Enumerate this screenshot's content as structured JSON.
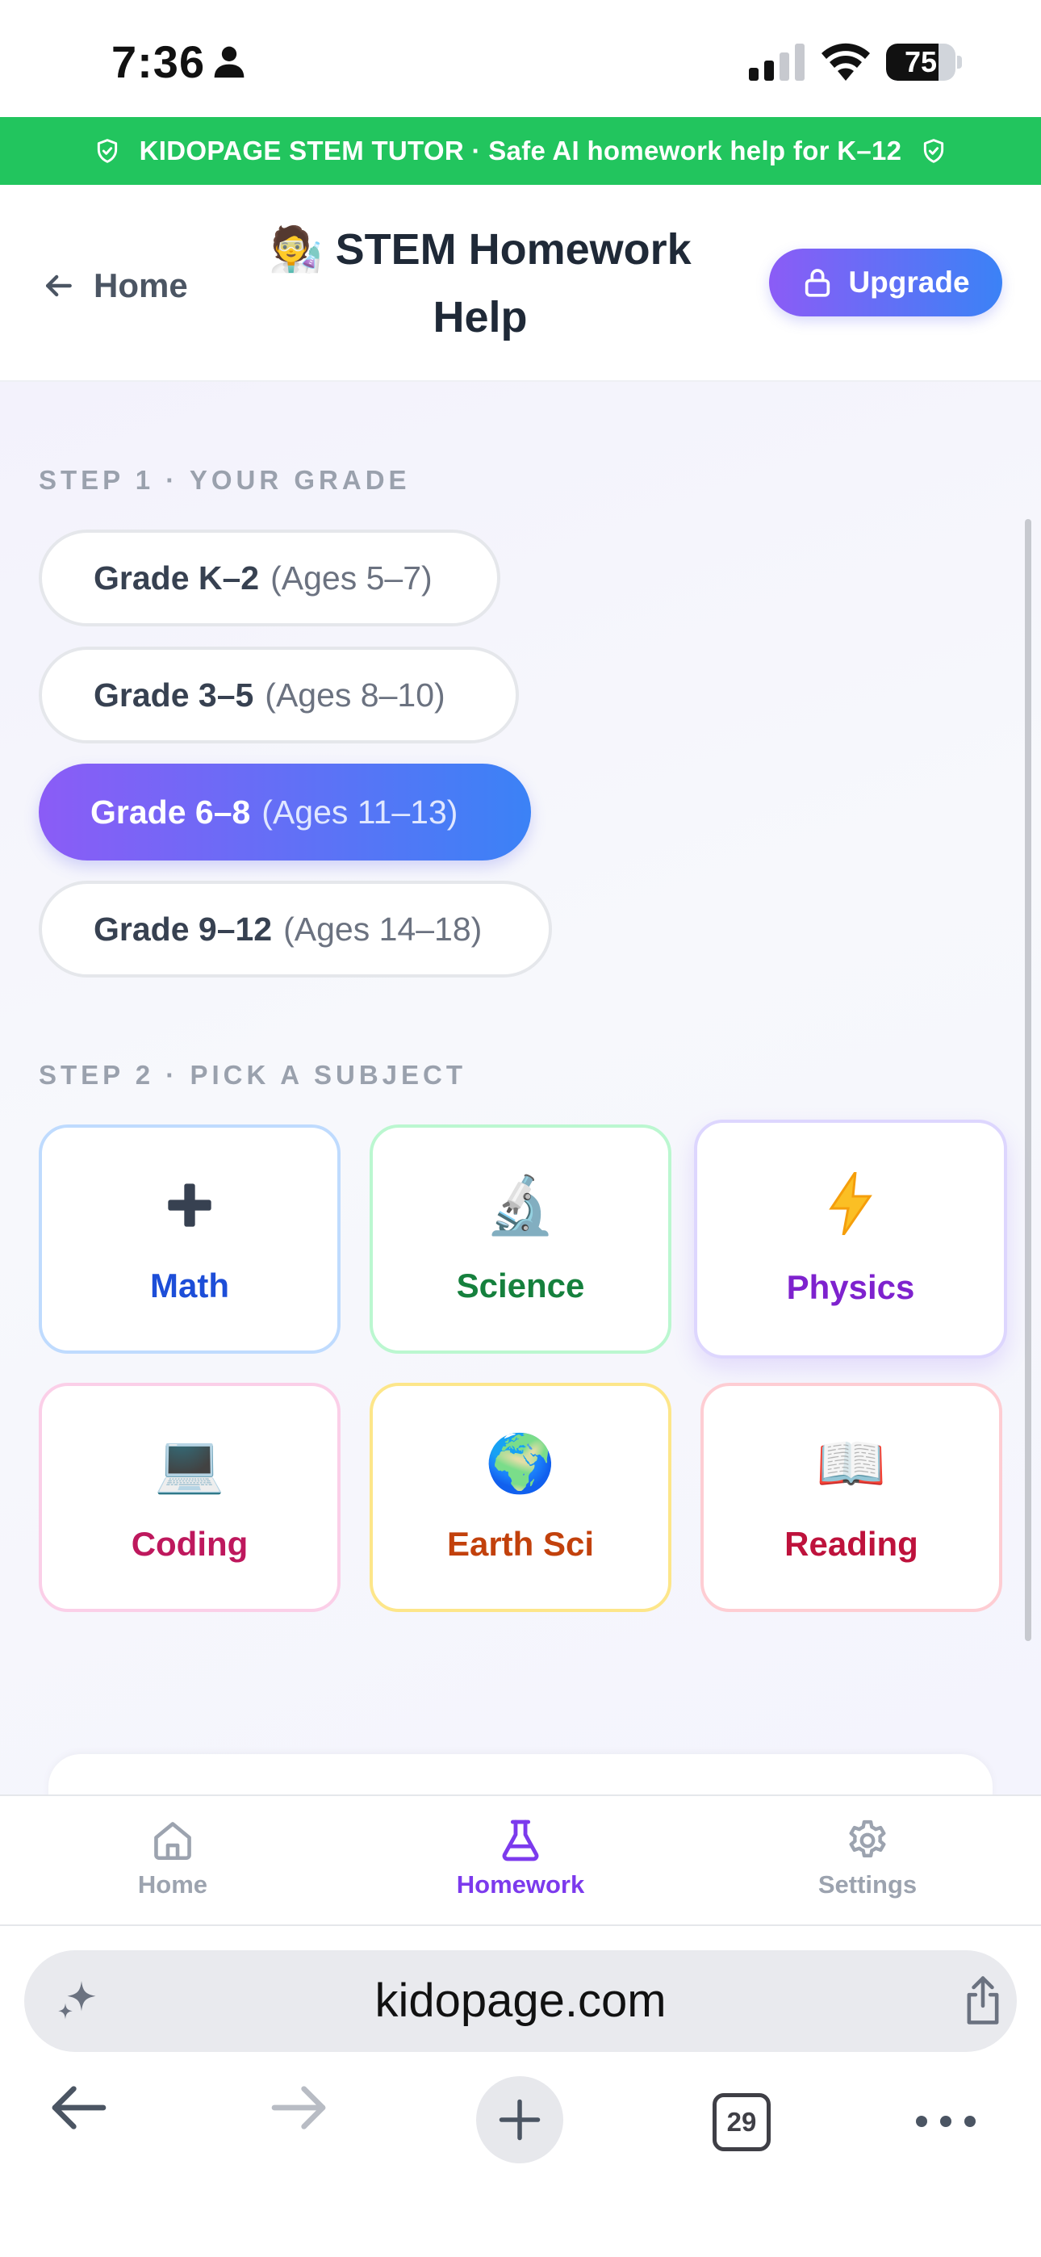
{
  "status_bar": {
    "time": "7:36",
    "battery": "75",
    "battery_level": 0.75
  },
  "banner": {
    "text": "KIDOPAGE STEM TUTOR · Safe AI homework help for K–12",
    "color": "#22c55e"
  },
  "header": {
    "back_label": "Home",
    "title": "🧑‍🔬 STEM Homework Help",
    "upgrade_label": "Upgrade",
    "accent_gradient": [
      "#8b5cf6",
      "#3b82f6"
    ]
  },
  "step1": {
    "label": "STEP 1 · YOUR GRADE",
    "grades": [
      {
        "name": "Grade K–2",
        "ages": "(Ages 5–7)",
        "selected": false
      },
      {
        "name": "Grade 3–5",
        "ages": "(Ages 8–10)",
        "selected": false
      },
      {
        "name": "Grade 6–8",
        "ages": "(Ages 11–13)",
        "selected": true
      },
      {
        "name": "Grade 9–12",
        "ages": "(Ages 14–18)",
        "selected": false
      }
    ]
  },
  "step2": {
    "label": "STEP 2 · PICK A SUBJECT",
    "subjects": [
      {
        "name": "Math",
        "icon": "➕",
        "icon_name": "plus-icon",
        "color": "#1d4ed8",
        "border": "#bfdbfe",
        "selected": false
      },
      {
        "name": "Science",
        "icon": "🔬",
        "icon_name": "microscope-icon",
        "color": "#15803d",
        "border": "#bbf7d0",
        "selected": false
      },
      {
        "name": "Physics",
        "icon": "⚡",
        "icon_name": "lightning-icon",
        "color": "#7e22ce",
        "border": "#ddd6fe",
        "selected": true
      },
      {
        "name": "Coding",
        "icon": "💻",
        "icon_name": "laptop-icon",
        "color": "#be185d",
        "border": "#fbcfe8",
        "selected": false
      },
      {
        "name": "Earth Sci",
        "icon": "🌍",
        "icon_name": "globe-icon",
        "color": "#c2410c",
        "border": "#fde68a",
        "selected": false
      },
      {
        "name": "Reading",
        "icon": "📖",
        "icon_name": "book-icon",
        "color": "#be123c",
        "border": "#fecdd3",
        "selected": false
      }
    ]
  },
  "tab_bar": {
    "items": [
      {
        "label": "Home",
        "icon": "home-icon",
        "active": false
      },
      {
        "label": "Homework",
        "icon": "flask-icon",
        "active": true
      },
      {
        "label": "Settings",
        "icon": "gear-icon",
        "active": false
      }
    ],
    "active_color": "#7c3aed"
  },
  "browser": {
    "url": "kidopage.com",
    "tab_count": "29"
  }
}
